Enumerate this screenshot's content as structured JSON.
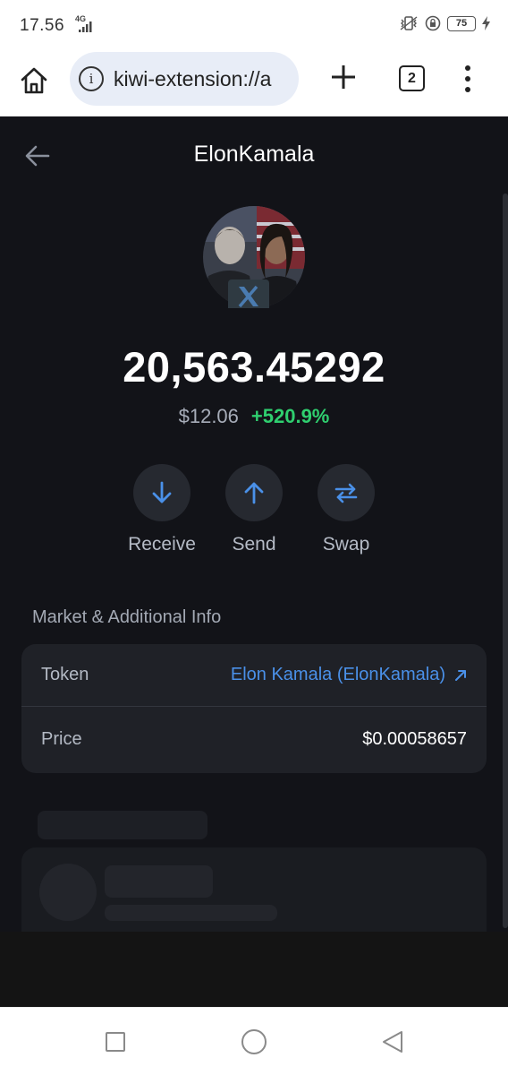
{
  "status_bar": {
    "time": "17.56",
    "network": "4G",
    "battery": "75"
  },
  "browser": {
    "url": "kiwi-extension://a",
    "tab_count": "2"
  },
  "token": {
    "title": "ElonKamala",
    "balance": "20,563.45292",
    "fiat_value": "$12.06",
    "change": "+520.9%"
  },
  "actions": [
    {
      "label": "Receive",
      "icon": "arrow-down-icon"
    },
    {
      "label": "Send",
      "icon": "arrow-up-icon"
    },
    {
      "label": "Swap",
      "icon": "swap-icon"
    }
  ],
  "market_info": {
    "section_title": "Market & Additional Info",
    "rows": [
      {
        "label": "Token",
        "value": "Elon Kamala (ElonKamala)",
        "link": true
      },
      {
        "label": "Price",
        "value": "$0.00058657",
        "link": false
      }
    ]
  },
  "colors": {
    "background": "#121318",
    "card": "#1f2127",
    "accent": "#4a90e8",
    "positive": "#2fcf6f"
  }
}
